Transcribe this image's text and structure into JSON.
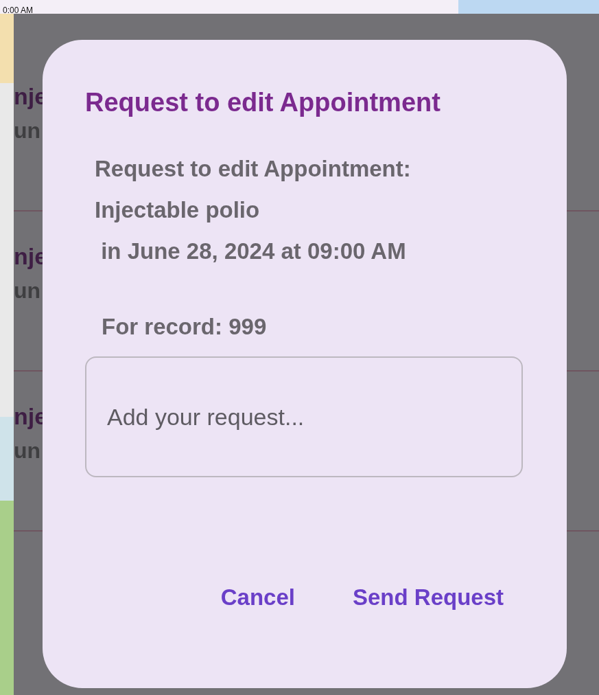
{
  "background": {
    "top_text": "0:00 AM",
    "list_items": [
      {
        "title": "nje",
        "subtitle": "un"
      },
      {
        "title": "nje",
        "subtitle": "un"
      },
      {
        "title": "nje",
        "subtitle": "un"
      }
    ]
  },
  "dialog": {
    "title": "Request to edit Appointment",
    "message_lines": [
      "Request to edit Appointment:",
      "Injectable polio",
      " in June 28, 2024 at 09:00 AM"
    ],
    "record": "For record: 999",
    "request_field": {
      "placeholder": "Add your request..."
    },
    "buttons": [
      "Cancel",
      "Send Request"
    ]
  }
}
